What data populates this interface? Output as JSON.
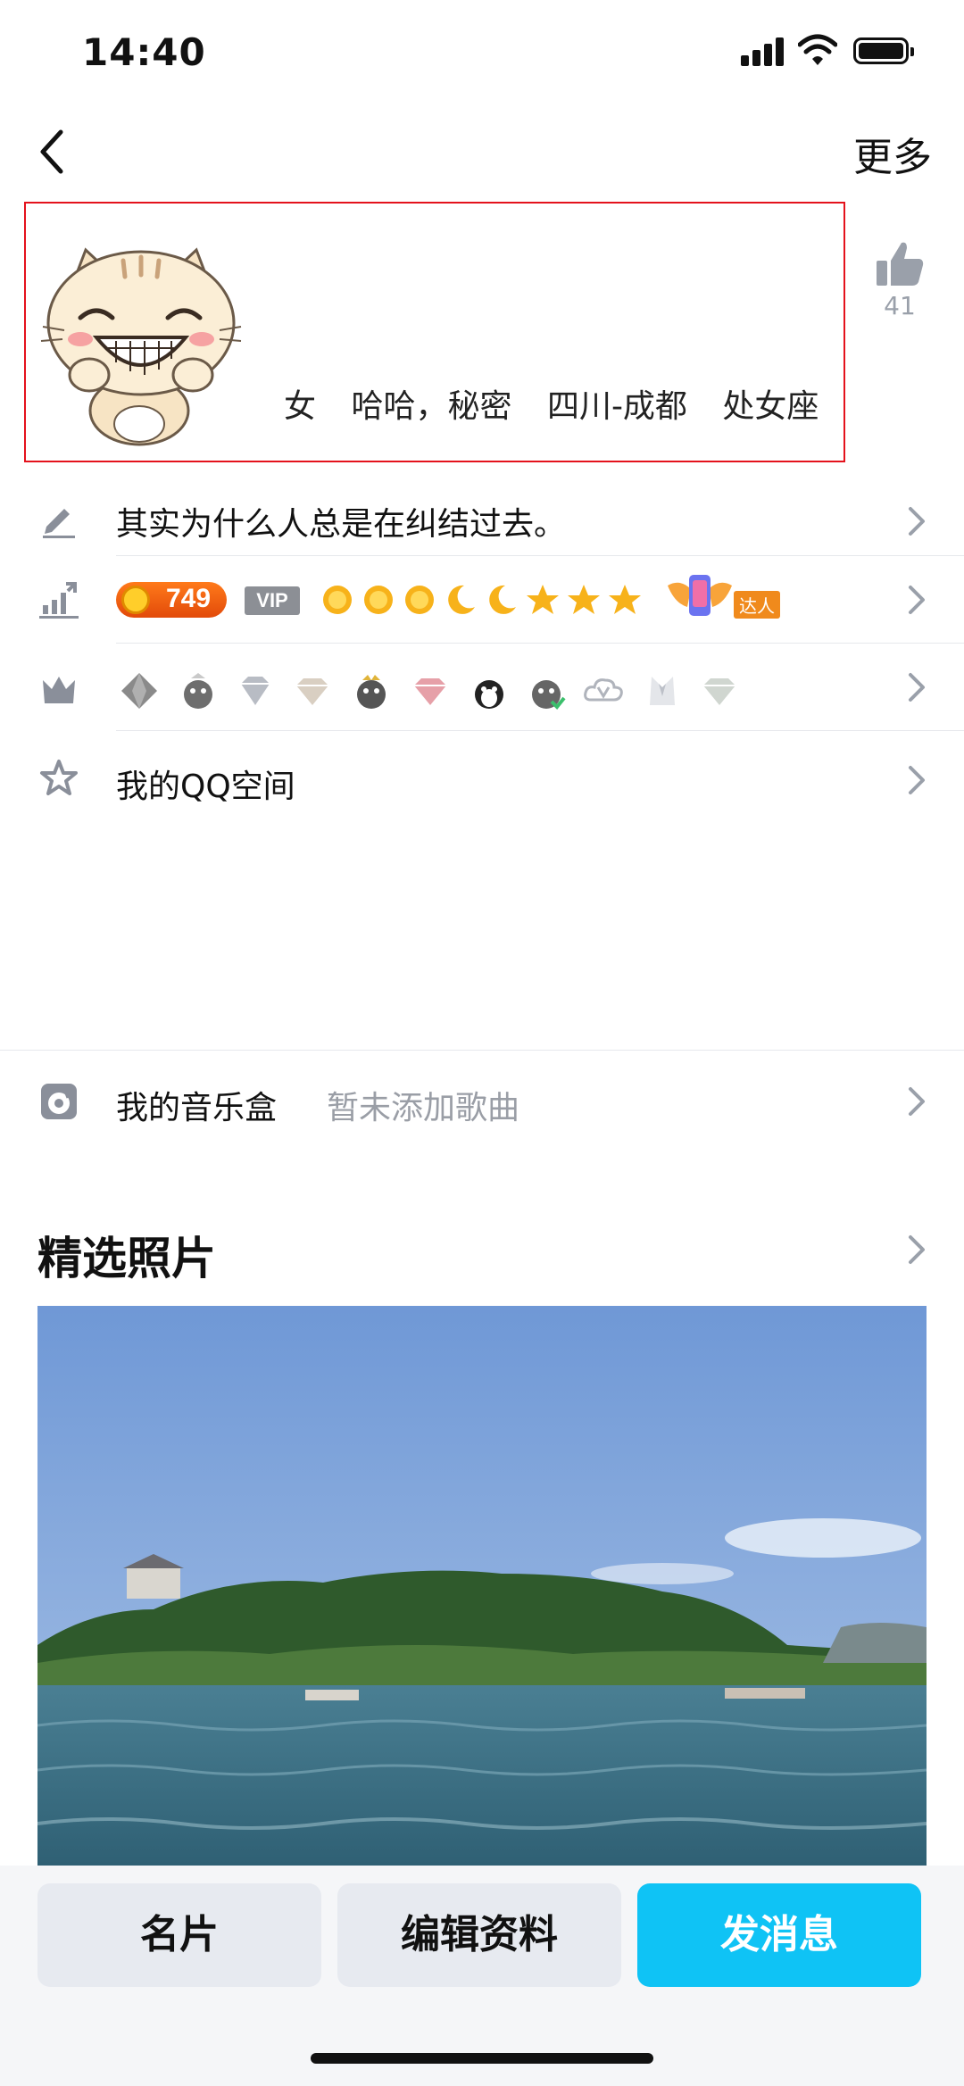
{
  "status_bar": {
    "time": "14:40"
  },
  "nav": {
    "more_label": "更多"
  },
  "profile": {
    "gender": "女",
    "age": "哈哈，秘密",
    "location": "四川-成都",
    "zodiac": "处女座",
    "like_count": "41"
  },
  "signature_row": {
    "text": "其实为什么人总是在纠结过去。"
  },
  "level_row": {
    "level": "749",
    "vip_tag": "VIP",
    "daren_label": "达人"
  },
  "qzone_row": {
    "label": "我的QQ空间"
  },
  "music_row": {
    "label": "我的音乐盒",
    "sub": "暂未添加歌曲"
  },
  "photos": {
    "title": "精选照片"
  },
  "buttons": {
    "card": "名片",
    "edit": "编辑资料",
    "message": "发消息"
  },
  "colors": {
    "accent": "#0fc3f5",
    "highlight_border": "#e4121c",
    "secondary_text": "#9a9ea6"
  },
  "icons": {
    "back": "chevron-left-icon",
    "like": "thumbs-up-icon",
    "signature": "pencil-icon",
    "level": "bar-chart-icon",
    "badges": "crown-icon",
    "qzone": "star-icon",
    "music": "music-disc-icon",
    "chevron": "chevron-right-icon"
  }
}
